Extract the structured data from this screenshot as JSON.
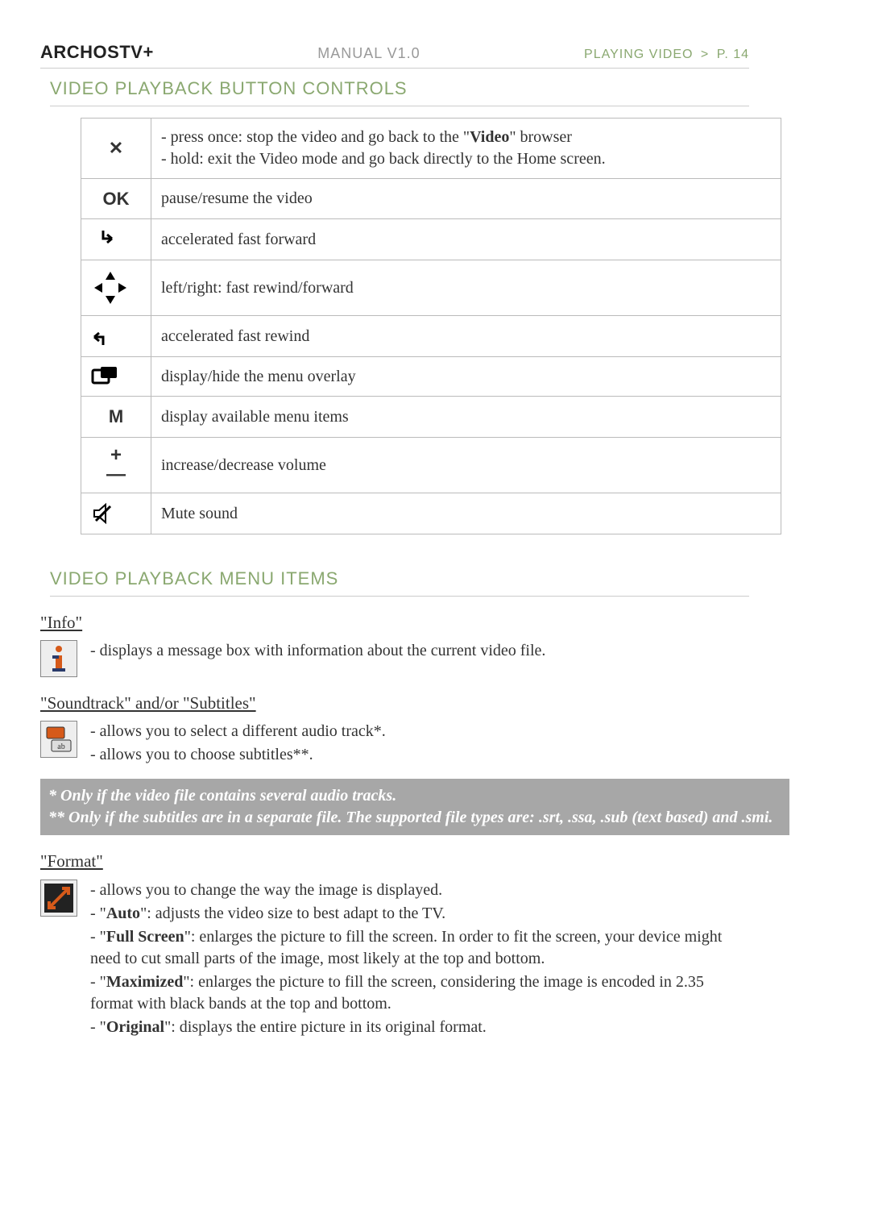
{
  "header": {
    "brand": "ARCHOS",
    "brand_suffix": "TV+",
    "manual": "MANUAL V1.0",
    "breadcrumb_section": "PLAYING VIDEO",
    "breadcrumb_chev": ">",
    "breadcrumb_page": "P. 14"
  },
  "section1_title": "VIDEO PLAYBACK BUTTON CONTROLS",
  "controls": [
    {
      "icon": "close-x-icon",
      "glyph": "✕",
      "desc_html": "- press once: stop the video and go back to the \"<b>Video</b>\" browser<br>- hold: exit the Video mode and go back directly to the Home screen."
    },
    {
      "icon": "ok-icon",
      "glyph": "OK",
      "desc": "pause/resume the video"
    },
    {
      "icon": "fast-forward-accel-icon",
      "glyph": "svg-ffwd",
      "desc": "accelerated fast forward"
    },
    {
      "icon": "dpad-icon",
      "glyph": "svg-dpad",
      "desc": "left/right: fast rewind/forward"
    },
    {
      "icon": "fast-rewind-accel-icon",
      "glyph": "svg-frew",
      "desc": "accelerated fast rewind"
    },
    {
      "icon": "overlay-toggle-icon",
      "glyph": "svg-overlay",
      "desc": "display/hide the menu overlay"
    },
    {
      "icon": "menu-m-icon",
      "glyph": "M",
      "desc": "display available menu items"
    },
    {
      "icon": "volume-plus-minus-icon",
      "glyph": "+-",
      "desc": "increase/decrease volume"
    },
    {
      "icon": "mute-icon",
      "glyph": "svg-mute",
      "desc": "Mute sound"
    }
  ],
  "section2_title": "VIDEO PLAYBACK MENU ITEMS",
  "info": {
    "title": "\"Info\"",
    "line1": "- displays a message box with information about the current video file."
  },
  "soundtrack": {
    "title": "\"Soundtrack\" and/or \"Subtitles\"",
    "line1": "- allows you to select a different audio track*.",
    "line2": "- allows you to choose subtitles**."
  },
  "note": {
    "line1": "* Only if the video file contains several audio tracks.",
    "line2": "** Only if the subtitles are in a separate file. The supported file types are: .srt, .ssa, .sub (text based) and .smi."
  },
  "format": {
    "title": "\"Format\"",
    "line1": "- allows you to change the way the image is displayed.",
    "auto_label": "Auto",
    "auto_text": ": adjusts the video size to best adapt to the TV.",
    "full_label": "Full Screen",
    "full_text": ": enlarges the picture to fill the screen. In order to fit the screen, your device might need to cut small parts of the image, most likely at the top and bottom.",
    "max_label": "Maximized",
    "max_text": ": enlarges the picture to fill the screen, considering the image is encoded in 2.35 format with black bands at the top and bottom.",
    "orig_label": "Original",
    "orig_text": ": displays the entire picture in its original format."
  }
}
